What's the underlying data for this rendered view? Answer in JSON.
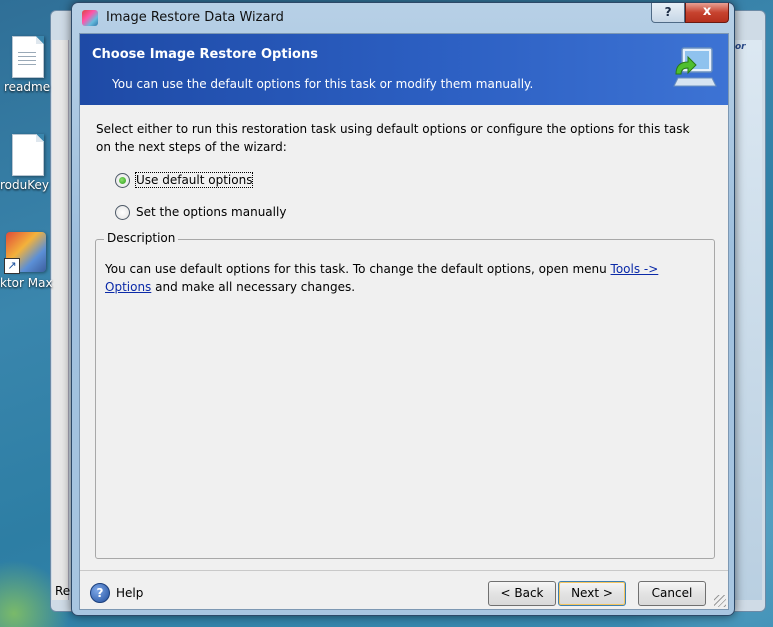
{
  "desktop": {
    "icons": [
      {
        "label": "readme"
      },
      {
        "label": "roduKey"
      },
      {
        "label": "ktor Max"
      }
    ],
    "background_window": {
      "bottom_text": "Re",
      "logo_text": "or"
    }
  },
  "window": {
    "title": "Image Restore Data Wizard",
    "help_caption": "?",
    "close_caption": "x"
  },
  "header": {
    "title": "Choose Image Restore Options",
    "subtitle": "You can use the default options for this task or modify them manually."
  },
  "intro_text": "Select either to run this restoration task using default options or configure the options for this task on the next steps of the wizard:",
  "options": [
    {
      "label": "Use default options",
      "checked": true
    },
    {
      "label": "Set the options manually",
      "checked": false
    }
  ],
  "description": {
    "legend": "Description",
    "text_before": "You can use default options for this task. To change the default options, open menu ",
    "link": "Tools ->  Options",
    "text_after": " and make all necessary changes."
  },
  "footer": {
    "help_label": "Help",
    "help_icon_glyph": "?",
    "back_label": "< Back",
    "next_label": "Next >",
    "cancel_label": "Cancel"
  },
  "colors": {
    "header_blue": "#2c5fc2",
    "link": "#0b2aa8",
    "radio_selected": "#2c9a1b"
  }
}
